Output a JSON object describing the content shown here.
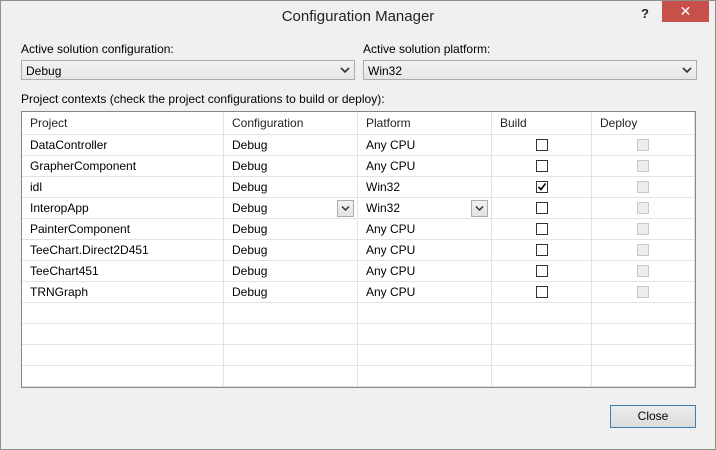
{
  "window": {
    "title": "Configuration Manager",
    "help_glyph": "?",
    "close_glyph": "✕"
  },
  "config": {
    "label": "Active solution configuration:",
    "value": "Debug"
  },
  "platform": {
    "label": "Active solution platform:",
    "value": "Win32"
  },
  "contexts_label": "Project contexts (check the project configurations to build or deploy):",
  "columns": [
    "Project",
    "Configuration",
    "Platform",
    "Build",
    "Deploy"
  ],
  "rows": [
    {
      "project": "DataController",
      "configuration": "Debug",
      "platform": "Any CPU",
      "build": false,
      "deploy": false
    },
    {
      "project": "GrapherComponent",
      "configuration": "Debug",
      "platform": "Any CPU",
      "build": false,
      "deploy": false
    },
    {
      "project": "idl",
      "configuration": "Debug",
      "platform": "Win32",
      "build": true,
      "deploy": false
    },
    {
      "project": "InteropApp",
      "configuration": "Debug",
      "platform": "Win32",
      "build": false,
      "deploy": false
    },
    {
      "project": "PainterComponent",
      "configuration": "Debug",
      "platform": "Any CPU",
      "build": false,
      "deploy": false
    },
    {
      "project": "TeeChart.Direct2D451",
      "configuration": "Debug",
      "platform": "Any CPU",
      "build": false,
      "deploy": false
    },
    {
      "project": "TeeChart451",
      "configuration": "Debug",
      "platform": "Any CPU",
      "build": false,
      "deploy": false
    },
    {
      "project": "TRNGraph",
      "configuration": "Debug",
      "platform": "Any CPU",
      "build": false,
      "deploy": false
    }
  ],
  "deploy_enabled": false,
  "close_button": "Close"
}
